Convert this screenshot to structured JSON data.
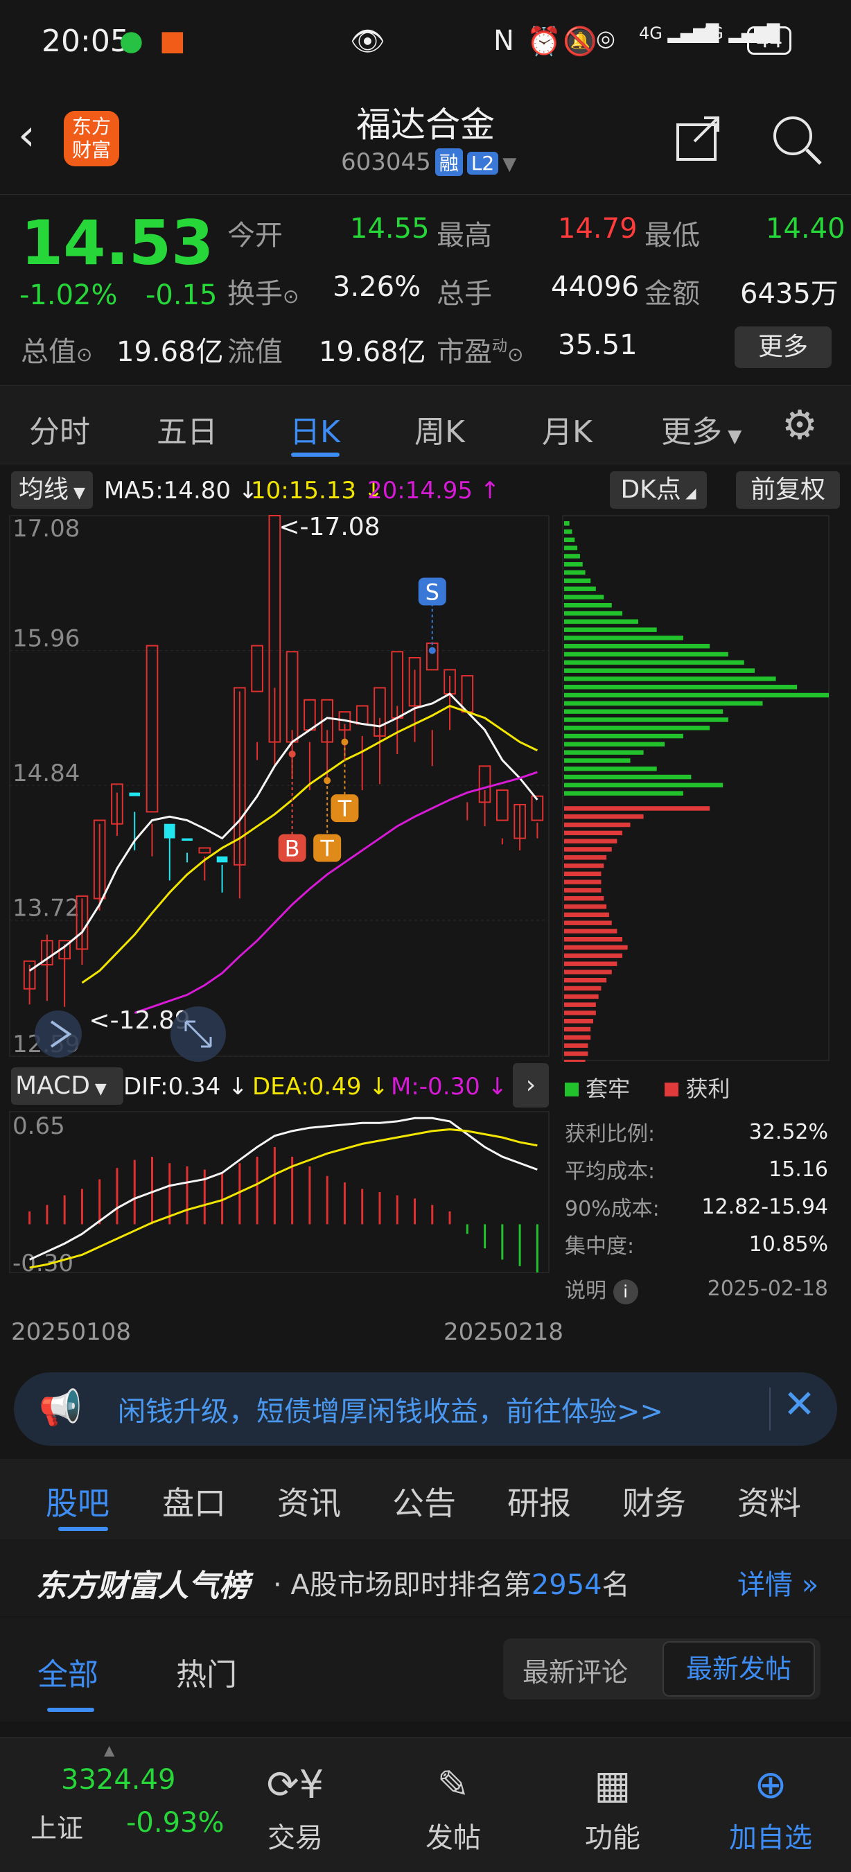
{
  "status_bar": {
    "time": "20:05",
    "battery": "44",
    "net1": "4G",
    "net2": "4G"
  },
  "header": {
    "title": "福达合金",
    "code": "603045",
    "tag1": "融",
    "tag2": "L2",
    "logo_line1": "东方",
    "logo_line2": "财富"
  },
  "quote": {
    "price": "14.53",
    "pct": "-1.02%",
    "chg": "-0.15",
    "open_label": "今开",
    "open": "14.55",
    "high_label": "最高",
    "high": "14.79",
    "low_label": "最低",
    "low": "14.40",
    "turnover_label": "换手",
    "turnover": "3.26%",
    "volume_label": "总手",
    "volume": "44096",
    "amount_label": "金额",
    "amount": "6435万",
    "mcap_label": "总值",
    "mcap": "19.68亿",
    "float_label": "流值",
    "float": "19.68亿",
    "pe_label": "市盈",
    "pe_sup": "动",
    "pe": "35.51",
    "more": "更多"
  },
  "k_tabs": [
    "分时",
    "五日",
    "日K",
    "周K",
    "月K",
    "更多"
  ],
  "indicators": {
    "ma_btn": "均线",
    "ma5": "MA5:14.80",
    "ma10": "10:15.13",
    "ma20": "20:14.95",
    "dk_btn": "DK点",
    "adjust_btn": "前复权"
  },
  "chart_data": {
    "type": "candlestick",
    "y_ticks": [
      "17.08",
      "15.96",
      "14.84",
      "13.72",
      "12.59"
    ],
    "high_label": "<-17.08",
    "low_label": "<-12.89",
    "signals": [
      "S",
      "B",
      "T",
      "T"
    ],
    "ohlc": [
      [
        13.15,
        13.38,
        13.02,
        13.35
      ],
      [
        13.35,
        13.55,
        13.05,
        13.6
      ],
      [
        13.4,
        13.55,
        13.0,
        13.52
      ],
      [
        13.48,
        13.92,
        13.35,
        13.9
      ],
      [
        13.9,
        14.55,
        13.8,
        14.52
      ],
      [
        14.52,
        14.85,
        14.42,
        14.78
      ],
      [
        14.78,
        14.75,
        14.3,
        14.62
      ],
      [
        14.62,
        16.0,
        14.25,
        14.52
      ],
      [
        14.52,
        14.4,
        14.05,
        14.4
      ],
      [
        14.4,
        14.38,
        14.2,
        14.28
      ],
      [
        14.28,
        14.32,
        14.05,
        14.25
      ],
      [
        14.25,
        14.2,
        13.95,
        14.18
      ],
      [
        14.18,
        15.65,
        13.9,
        15.62
      ],
      [
        15.62,
        16.0,
        15.05,
        15.2
      ],
      [
        15.2,
        17.08,
        15.0,
        15.65
      ],
      [
        15.2,
        15.95,
        14.9,
        15.3
      ],
      [
        15.3,
        15.55,
        14.8,
        15.2
      ],
      [
        15.2,
        15.55,
        14.85,
        15.3
      ],
      [
        15.3,
        15.45,
        15.05,
        15.35
      ],
      [
        15.35,
        15.5,
        14.8,
        15.25
      ],
      [
        15.25,
        15.65,
        14.85,
        15.4
      ],
      [
        15.4,
        15.95,
        15.1,
        15.5
      ],
      [
        15.5,
        15.9,
        15.2,
        15.8
      ],
      [
        15.8,
        16.02,
        15.0,
        15.3
      ],
      [
        15.6,
        15.8,
        15.3,
        15.75
      ],
      [
        15.45,
        15.75,
        14.55,
        14.7
      ],
      [
        14.7,
        15.0,
        14.5,
        14.8
      ],
      [
        14.55,
        14.8,
        14.35,
        14.4
      ],
      [
        14.4,
        14.68,
        14.3,
        14.68
      ],
      [
        14.55,
        14.75,
        14.4,
        14.53
      ]
    ],
    "ma5": [
      13.3,
      13.4,
      13.5,
      13.62,
      13.85,
      14.15,
      14.38,
      14.55,
      14.58,
      14.55,
      14.48,
      14.4,
      14.55,
      14.75,
      15.0,
      15.2,
      15.3,
      15.4,
      15.38,
      15.35,
      15.33,
      15.4,
      15.48,
      15.52,
      15.6,
      15.45,
      15.3,
      15.05,
      14.9,
      14.72
    ],
    "ma10": [
      null,
      null,
      null,
      13.2,
      13.3,
      13.45,
      13.6,
      13.78,
      13.95,
      14.1,
      14.22,
      14.32,
      14.4,
      14.5,
      14.6,
      14.72,
      14.85,
      14.95,
      15.05,
      15.12,
      15.2,
      15.28,
      15.35,
      15.42,
      15.5,
      15.45,
      15.4,
      15.3,
      15.2,
      15.13
    ],
    "ma20": [
      null,
      null,
      null,
      null,
      null,
      null,
      12.95,
      13.0,
      13.05,
      13.1,
      13.18,
      13.28,
      13.42,
      13.55,
      13.7,
      13.85,
      13.98,
      14.1,
      14.2,
      14.3,
      14.4,
      14.5,
      14.58,
      14.65,
      14.72,
      14.78,
      14.82,
      14.86,
      14.9,
      14.95
    ],
    "macd": {
      "label": "MACD",
      "dif": "DIF:0.34",
      "dea": "DEA:0.49",
      "m": "M:-0.30",
      "y_ticks": [
        "0.65",
        "-0.30"
      ],
      "hist": [
        0.08,
        0.12,
        0.18,
        0.22,
        0.28,
        0.35,
        0.4,
        0.42,
        0.38,
        0.36,
        0.34,
        0.32,
        0.38,
        0.42,
        0.48,
        0.42,
        0.36,
        0.3,
        0.26,
        0.22,
        0.2,
        0.18,
        0.16,
        0.12,
        0.08,
        -0.06,
        -0.15,
        -0.22,
        -0.26,
        -0.3
      ],
      "dif_line": [
        -0.22,
        -0.17,
        -0.12,
        -0.06,
        0.02,
        0.1,
        0.16,
        0.2,
        0.24,
        0.26,
        0.28,
        0.32,
        0.4,
        0.48,
        0.55,
        0.58,
        0.6,
        0.61,
        0.62,
        0.63,
        0.63,
        0.64,
        0.66,
        0.66,
        0.64,
        0.56,
        0.48,
        0.42,
        0.38,
        0.34
      ],
      "dea_line": [
        -0.27,
        -0.25,
        -0.22,
        -0.19,
        -0.14,
        -0.09,
        -0.04,
        0.01,
        0.05,
        0.09,
        0.12,
        0.15,
        0.2,
        0.25,
        0.31,
        0.36,
        0.4,
        0.44,
        0.47,
        0.5,
        0.52,
        0.54,
        0.56,
        0.58,
        0.59,
        0.58,
        0.56,
        0.54,
        0.51,
        0.49
      ]
    },
    "x_start": "20250108",
    "x_end": "20250218"
  },
  "chip": {
    "legend_trap": "套牢",
    "legend_profit": "获利",
    "rows": [
      {
        "label": "获利比例:",
        "value": "32.52%"
      },
      {
        "label": "平均成本:",
        "value": "15.16"
      },
      {
        "label": "90%成本:",
        "value": "12.82-15.94"
      },
      {
        "label": "集中度:",
        "value": "10.85%"
      }
    ],
    "note_label": "说明",
    "date": "2025-02-18",
    "green_bars": [
      0.02,
      0.03,
      0.04,
      0.05,
      0.06,
      0.07,
      0.08,
      0.1,
      0.12,
      0.15,
      0.18,
      0.22,
      0.28,
      0.35,
      0.45,
      0.55,
      0.62,
      0.68,
      0.72,
      0.8,
      0.88,
      1.0,
      0.75,
      0.6,
      0.62,
      0.55,
      0.45,
      0.38,
      0.3,
      0.25,
      0.35,
      0.48,
      0.6,
      0.45
    ],
    "red_bars": [
      0.55,
      0.3,
      0.25,
      0.22,
      0.2,
      0.18,
      0.16,
      0.15,
      0.14,
      0.14,
      0.14,
      0.15,
      0.16,
      0.17,
      0.18,
      0.2,
      0.22,
      0.24,
      0.22,
      0.2,
      0.18,
      0.16,
      0.14,
      0.13,
      0.12,
      0.12,
      0.11,
      0.1,
      0.1,
      0.09,
      0.09,
      0.08,
      0.08
    ]
  },
  "banner": {
    "text": "闲钱升级，短债增厚闲钱收益，前往体验>>"
  },
  "sub_tabs": [
    "股吧",
    "盘口",
    "资讯",
    "公告",
    "研报",
    "财务",
    "资料"
  ],
  "rank": {
    "title": "东方财富人气榜",
    "text_pre": "· A股市场即时排名第",
    "num": "2954",
    "text_post": "名",
    "link": "详情"
  },
  "filters": {
    "all": "全部",
    "hot": "热门",
    "latest_comment": "最新评论",
    "latest_post": "最新发帖"
  },
  "bottom_nav": {
    "index_value": "3324.49",
    "index_name": "上证",
    "index_pct": "-0.93%",
    "trade": "交易",
    "post": "发帖",
    "func": "功能",
    "add": "加自选"
  }
}
